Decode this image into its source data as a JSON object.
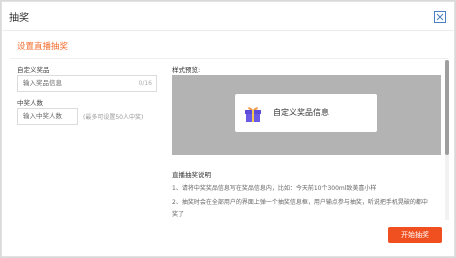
{
  "dialog": {
    "title": "抽奖",
    "section_title": "设置直播抽奖"
  },
  "form": {
    "prize_label": "自定义奖品",
    "prize_placeholder": "输入奖品信息",
    "prize_counter": "0/16",
    "winners_label": "中奖人数",
    "winners_placeholder": "输入中奖人数",
    "winners_hint": "(最多可设置50人中奖)"
  },
  "preview": {
    "label": "样式预览:",
    "card_text": "自定义奖品信息"
  },
  "description": {
    "title": "直播抽奖说明",
    "line1": "1、请将中奖奖品信息写在奖品信息内，比如：今天前10个300ml致美喜小样",
    "line2": "2、抽奖时会在全部用户的界面上弹一个抽奖信息框，用户输点参与抽奖，听说把手机晃破的都中",
    "line3": "奖了"
  },
  "actions": {
    "start_label": "开始抽奖"
  },
  "colors": {
    "accent": "#f36d2e",
    "button": "#f0501f",
    "preview_bg": "#b3b3b3"
  }
}
